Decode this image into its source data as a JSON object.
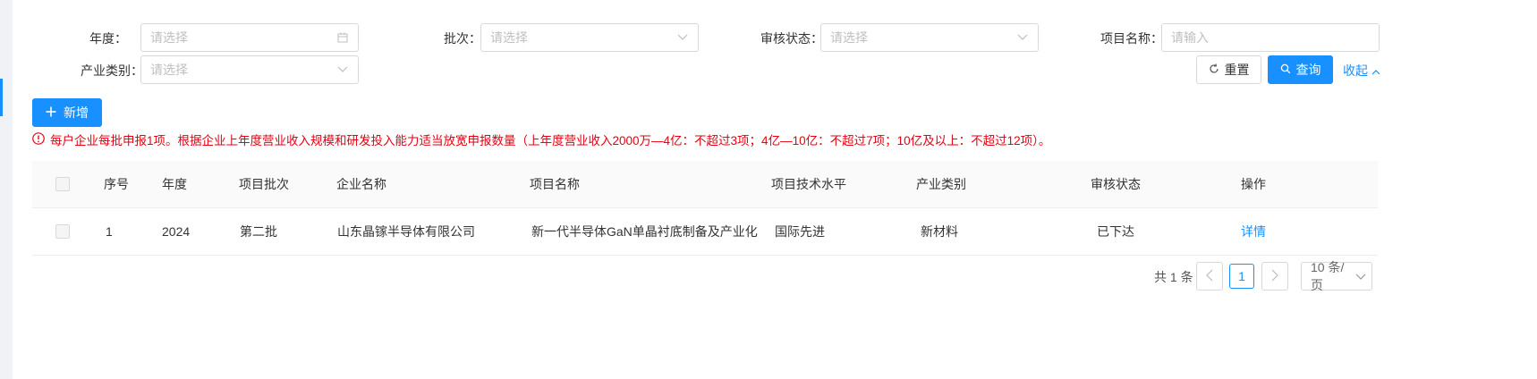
{
  "filters": {
    "year": {
      "label": "年度：",
      "placeholder": "请选择",
      "icon": "calendar-icon"
    },
    "batch": {
      "label": "批次：",
      "placeholder": "请选择",
      "icon": "chevron-down-icon"
    },
    "review_status": {
      "label": "审核状态：",
      "placeholder": "请选择",
      "icon": "chevron-down-icon"
    },
    "project_name": {
      "label": "项目名称：",
      "placeholder": "请输入"
    },
    "industry": {
      "label": "产业类别：",
      "placeholder": "请选择",
      "icon": "chevron-down-icon"
    }
  },
  "actions": {
    "reset_label": "重置",
    "search_label": "查询",
    "collapse_label": "收起",
    "add_label": "新增"
  },
  "notice": "每户企业每批申报1项。根据企业上年度营业收入规模和研发投入能力适当放宽申报数量（上年度营业收入2000万—4亿：不超过3项；4亿—10亿：不超过7项；10亿及以上：不超过12项）。",
  "table": {
    "columns": [
      "序号",
      "年度",
      "项目批次",
      "企业名称",
      "项目名称",
      "项目技术水平",
      "产业类别",
      "审核状态",
      "操作"
    ],
    "rows": [
      {
        "index": "1",
        "year": "2024",
        "batch": "第二批",
        "company": "山东晶镓半导体有限公司",
        "project": "新一代半导体GaN单晶衬底制备及产业化",
        "tech_level": "国际先进",
        "industry": "新材料",
        "status": "已下达",
        "action": "详情"
      }
    ]
  },
  "pagination": {
    "total_text": "共 1 条",
    "current_page": "1",
    "page_size": "10 条/页"
  },
  "colors": {
    "primary": "#1890ff",
    "notice": "#e60012"
  }
}
